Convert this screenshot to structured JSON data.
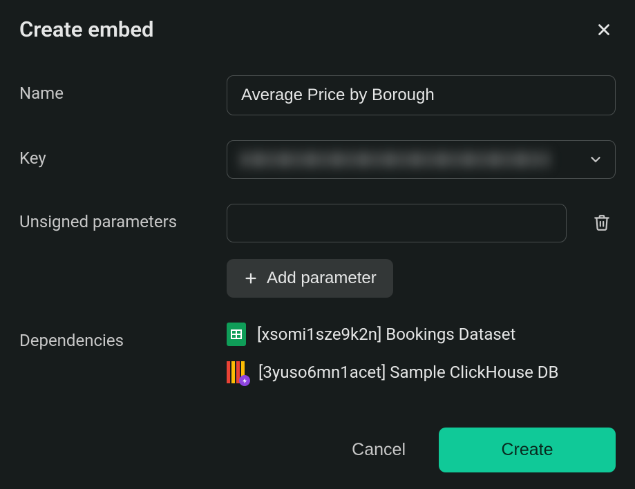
{
  "modal": {
    "title": "Create embed"
  },
  "form": {
    "name": {
      "label": "Name",
      "value": "Average Price by Borough"
    },
    "key": {
      "label": "Key"
    },
    "unsignedParams": {
      "label": "Unsigned parameters",
      "addButtonLabel": "Add parameter"
    },
    "dependencies": {
      "label": "Dependencies",
      "items": [
        {
          "text": "[xsomi1sze9k2n] Bookings Dataset",
          "icon": "sheets"
        },
        {
          "text": "[3yuso6mn1acet] Sample ClickHouse DB",
          "icon": "clickhouse"
        }
      ]
    }
  },
  "footer": {
    "cancelLabel": "Cancel",
    "createLabel": "Create"
  }
}
